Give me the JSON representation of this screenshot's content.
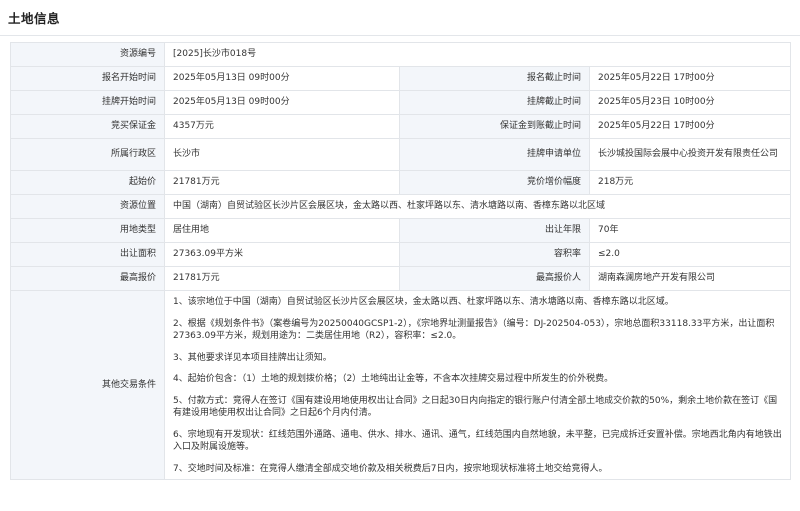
{
  "page_title": "土地信息",
  "rows": [
    {
      "l1": "资源编号",
      "v1": "[2025]长沙市018号"
    },
    {
      "l1": "报名开始时间",
      "v1": "2025年05月13日 09时00分",
      "l2": "报名截止时间",
      "v2": "2025年05月22日 17时00分"
    },
    {
      "l1": "挂牌开始时间",
      "v1": "2025年05月13日 09时00分",
      "l2": "挂牌截止时间",
      "v2": "2025年05月23日 10时00分"
    },
    {
      "l1": "竞买保证金",
      "v1": "4357万元",
      "l2": "保证金到账截止时间",
      "v2": "2025年05月22日 17时00分"
    },
    {
      "l1": "所属行政区",
      "v1": "长沙市",
      "l2": "挂牌申请单位",
      "v2": "长沙城投国际会展中心投资开发有限责任公司"
    },
    {
      "l1": "起始价",
      "v1": "21781万元",
      "l2": "竞价增价幅度",
      "v2": "218万元"
    },
    {
      "l1": "资源位置",
      "v1": "中国（湖南）自贸试验区长沙片区会展区块，金太路以西、杜家坪路以东、清水塘路以南、香樟东路以北区域"
    },
    {
      "l1": "用地类型",
      "v1": "居住用地",
      "l2": "出让年限",
      "v2": "70年"
    },
    {
      "l1": "出让面积",
      "v1": "27363.09平方米",
      "l2": "容积率",
      "v2": "≤2.0"
    },
    {
      "l1": "最高报价",
      "v1": "21781万元",
      "l2": "最高报价人",
      "v2": "湖南森澜房地产开发有限公司"
    }
  ],
  "conditions": {
    "label": "其他交易条件",
    "items": [
      "1、该宗地位于中国（湖南）自贸试验区长沙片区会展区块，金太路以西、杜家坪路以东、清水塘路以南、香樟东路以北区域。",
      "2、根据《规划条件书》（案卷编号为20250040GCSP1-2），《宗地界址测量报告》（编号：DJ-202504-053），宗地总面积33118.33平方米，出让面积27363.09平方米，规划用途为：二类居住用地（R2），容积率：≤2.0。",
      "3、其他要求详见本项目挂牌出让须知。",
      "4、起始价包含：（1）土地的规划拨价格；（2）土地纯出让金等，不含本次挂牌交易过程中所发生的价外税费。",
      "5、付款方式：竞得人在签订《国有建设用地使用权出让合同》之日起30日内向指定的银行账户付清全部土地成交价款的50%，剩余土地价款在签订《国有建设用地使用权出让合同》之日起6个月内付清。",
      "6、宗地现有开发现状：红线范围外通路、通电、供水、排水、通讯、通气，红线范围内自然地貌，未平整，已完成拆迁安置补偿。宗地西北角内有地铁出入口及附属设施等。",
      "7、交地时间及标准：在竞得人缴清全部成交地价款及相关税费后7日内，按宗地现状标准将土地交给竞得人。"
    ]
  }
}
